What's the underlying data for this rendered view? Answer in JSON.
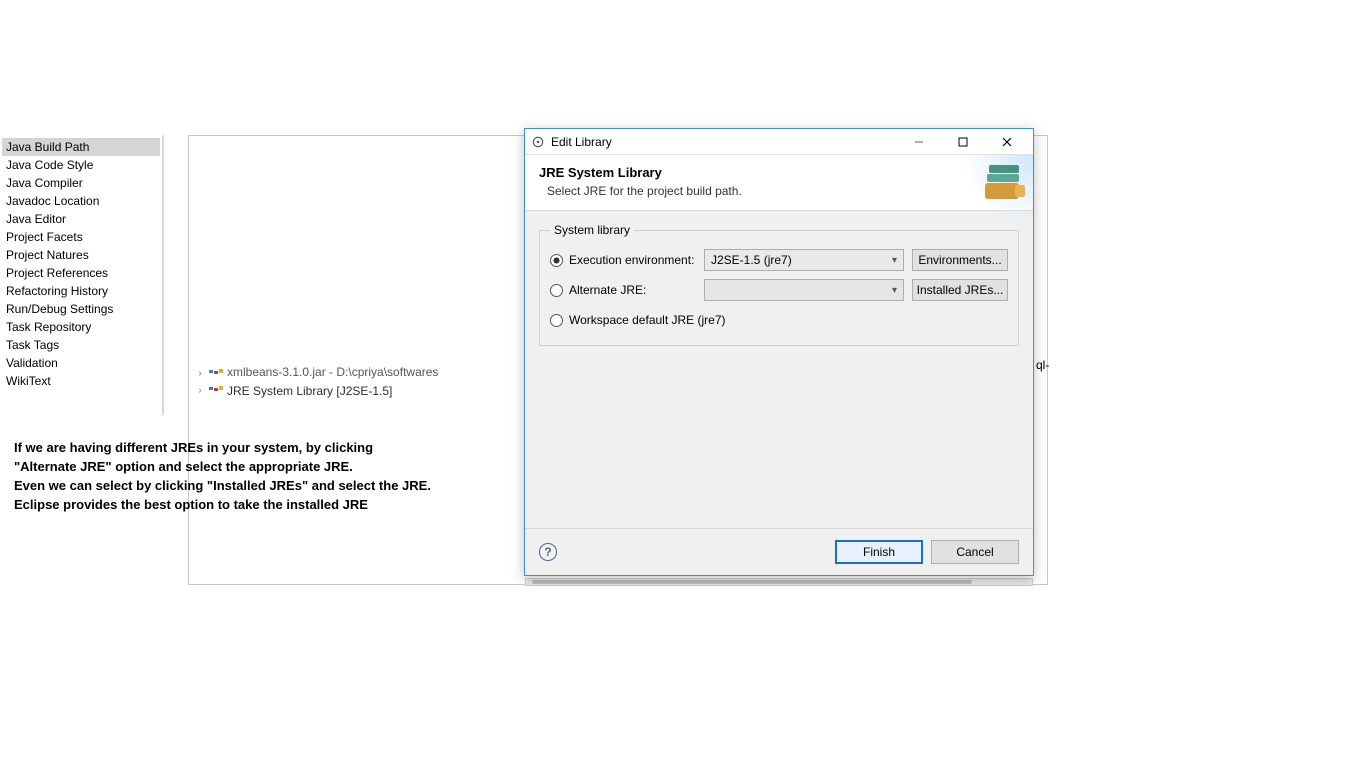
{
  "sidebar": {
    "items": [
      {
        "label": "Java Build Path",
        "selected": true
      },
      {
        "label": "Java Code Style"
      },
      {
        "label": "Java Compiler"
      },
      {
        "label": "Javadoc Location"
      },
      {
        "label": "Java Editor"
      },
      {
        "label": "Project Facets"
      },
      {
        "label": "Project Natures"
      },
      {
        "label": "Project References"
      },
      {
        "label": "Refactoring History"
      },
      {
        "label": "Run/Debug Settings"
      },
      {
        "label": "Task Repository"
      },
      {
        "label": "Task Tags"
      },
      {
        "label": "Validation"
      },
      {
        "label": "WikiText"
      }
    ]
  },
  "bg_tree": {
    "row1": "xmlbeans-3.1.0.jar - D:\\cpriya\\softwares",
    "row2": "JRE System Library [J2SE-1.5]"
  },
  "instructions": {
    "l1": "If we are having different JREs in your system, by clicking",
    "l2": "\"Alternate JRE\" option and select the appropriate JRE.",
    "l3": "Even we can select by clicking \"Installed JREs\" and select the JRE.",
    "l4": "Eclipse provides the best option to take the installed JRE"
  },
  "dialog": {
    "title": "Edit Library",
    "header_title": "JRE System Library",
    "header_sub": "Select JRE for the project build path.",
    "group_legend": "System library",
    "exec_env_label": "Execution environment:",
    "exec_env_value": "J2SE-1.5 (jre7)",
    "environments_btn": "Environments...",
    "alt_jre_label": "Alternate JRE:",
    "alt_jre_value": "",
    "installed_jres_btn": "Installed JREs...",
    "workspace_default_label": "Workspace default JRE (jre7)",
    "finish": "Finish",
    "cancel": "Cancel"
  },
  "cutoff": "ql-"
}
